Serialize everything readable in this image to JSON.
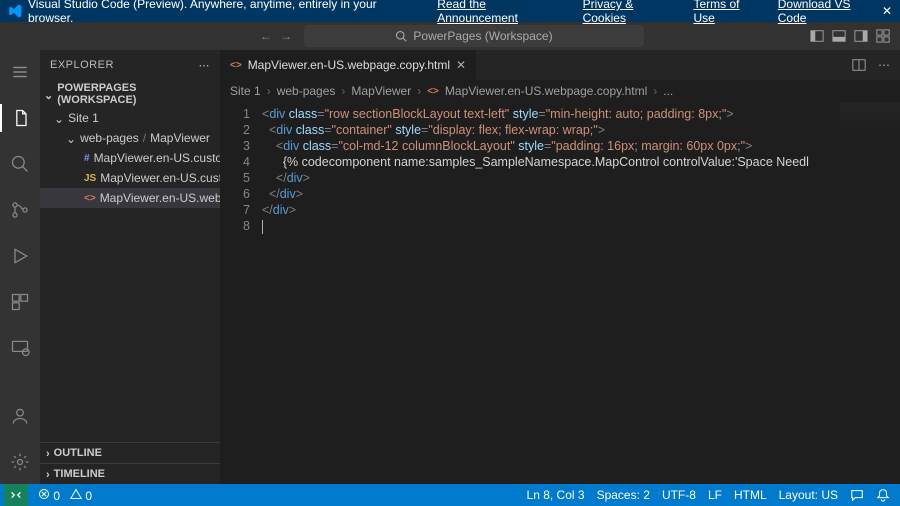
{
  "banner": {
    "product": "Visual Studio Code (Preview). Anywhere, anytime, entirely in your browser.",
    "links": {
      "announcement": "Read the Announcement",
      "privacy": "Privacy & Cookies",
      "terms": "Terms of Use",
      "download": "Download VS Code"
    },
    "close": "✕"
  },
  "titlebar": {
    "search_label": "PowerPages (Workspace)"
  },
  "sidebar": {
    "title": "EXPLORER",
    "workspace_section": "POWERPAGES (WORKSPACE)",
    "tree": {
      "site": "Site 1",
      "webpages": "web-pages",
      "mapviewer": "MapViewer",
      "files": [
        "MapViewer.en-US.customc...",
        "MapViewer.en-US.customj...",
        "MapViewer.en-US.webpag..."
      ]
    },
    "outline": "OUTLINE",
    "timeline": "TIMELINE"
  },
  "tab": {
    "filename": "MapViewer.en-US.webpage.copy.html"
  },
  "breadcrumb": {
    "parts": [
      "Site 1",
      "web-pages",
      "MapViewer",
      "MapViewer.en-US.webpage.copy.html",
      "..."
    ]
  },
  "code": {
    "line_numbers": [
      "1",
      "2",
      "3",
      "4",
      "5",
      "6",
      "7",
      "8"
    ],
    "lines": [
      {
        "indent": 0,
        "open": true,
        "tag": "div",
        "attrs": [
          [
            "class",
            "row sectionBlockLayout text-left"
          ],
          [
            "style",
            "min-height: auto; padding: 8px;"
          ]
        ]
      },
      {
        "indent": 1,
        "open": true,
        "tag": "div",
        "attrs": [
          [
            "class",
            "container"
          ],
          [
            "style",
            "display: flex; flex-wrap: wrap;"
          ]
        ]
      },
      {
        "indent": 2,
        "open": true,
        "tag": "div",
        "attrs": [
          [
            "class",
            "col-md-12 columnBlockLayout"
          ],
          [
            "style",
            "padding: 16px; margin: 60px 0px;"
          ]
        ]
      },
      {
        "indent": 3,
        "text": "{% codecomponent name:samples_SampleNamespace.MapControl controlValue:'Space Needl"
      },
      {
        "indent": 2,
        "close": true,
        "tag": "div"
      },
      {
        "indent": 1,
        "close": true,
        "tag": "div"
      },
      {
        "indent": 0,
        "close": true,
        "tag": "div"
      },
      {
        "indent": 0,
        "cursor": true
      }
    ]
  },
  "status": {
    "errors": "0",
    "warnings": "0",
    "line_col": "Ln 8, Col 3",
    "spaces": "Spaces: 2",
    "encoding": "UTF-8",
    "eol": "LF",
    "language": "HTML",
    "layout": "Layout: US"
  }
}
